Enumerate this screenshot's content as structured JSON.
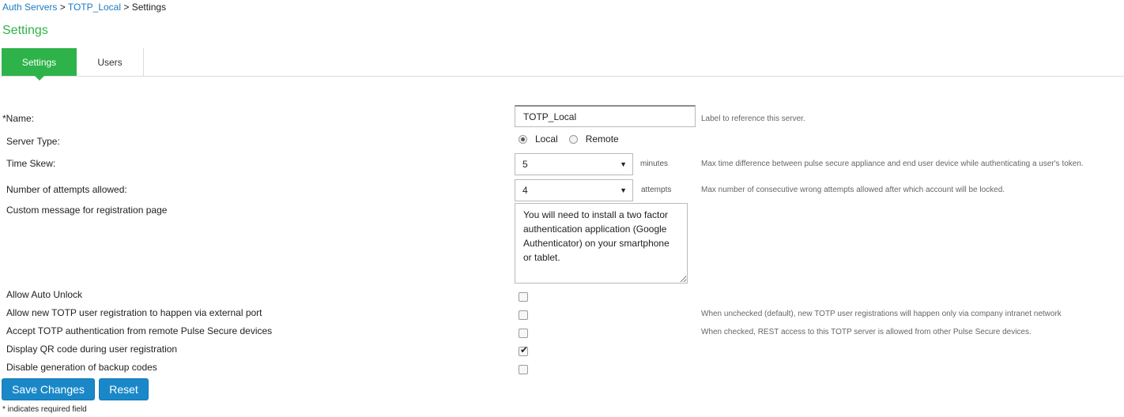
{
  "breadcrumb": {
    "items": [
      "Auth Servers",
      "TOTP_Local"
    ],
    "separator": ">",
    "current": "Settings"
  },
  "page_title": "Settings",
  "tabs": [
    {
      "label": "Settings",
      "active": true
    },
    {
      "label": "Users",
      "active": false
    }
  ],
  "form": {
    "name": {
      "label": "*Name:",
      "value": "TOTP_Local",
      "hint": "Label to reference this server."
    },
    "server_type": {
      "label": "Server Type:",
      "options": [
        {
          "label": "Local",
          "selected": true
        },
        {
          "label": "Remote",
          "selected": false
        }
      ]
    },
    "time_skew": {
      "label": "Time Skew:",
      "value": "5",
      "unit": "minutes",
      "hint": "Max time difference between pulse secure appliance and end user device while authenticating a user's token."
    },
    "attempts": {
      "label": "Number of attempts allowed:",
      "value": "4",
      "unit": "attempts",
      "hint": "Max number of consecutive wrong attempts allowed after which account will be locked."
    },
    "custom_message": {
      "label": "Custom message for registration page",
      "value": "You will need to install a two factor authentication application (Google Authenticator) on your smartphone or tablet."
    },
    "checkboxes": [
      {
        "label": "Allow Auto Unlock",
        "checked": false,
        "hint": ""
      },
      {
        "label": "Allow new TOTP user registration to happen via external port",
        "checked": false,
        "hint": "When unchecked (default), new TOTP user registrations will happen only via company intranet network"
      },
      {
        "label": "Accept TOTP authentication from remote Pulse Secure devices",
        "checked": false,
        "hint": "When checked, REST access to this TOTP server is allowed from other Pulse Secure devices."
      },
      {
        "label": "Display QR code during user registration",
        "checked": true,
        "hint": ""
      },
      {
        "label": "Disable generation of backup codes",
        "checked": false,
        "hint": ""
      }
    ]
  },
  "buttons": {
    "save": "Save Changes",
    "reset": "Reset"
  },
  "footnote": "* indicates required field",
  "colors": {
    "accent_green": "#2eb34a",
    "link_blue": "#1a7bbf",
    "button_blue": "#1a88c8"
  },
  "icons": {
    "dropdown": "chevron-down-icon",
    "checkmark": "checkmark-icon"
  }
}
